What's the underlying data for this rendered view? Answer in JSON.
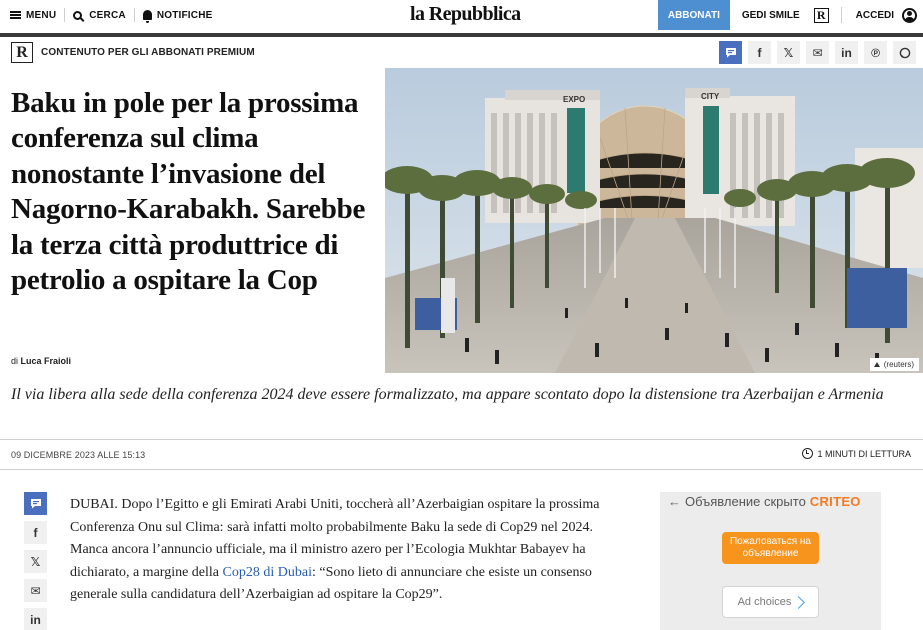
{
  "nav": {
    "menu_label": "MENU",
    "search_label": "CERCA",
    "notifications_label": "NOTIFICHE",
    "logo_text": "la Repubblica",
    "subscribe_label": "ABBONATI",
    "gedi_label": "GEDI SMILE",
    "r_logo": "R",
    "login_label": "ACCEDI"
  },
  "premium": {
    "logo": "R",
    "label": "CONTENUTO PER GLI ABBONATI PREMIUM"
  },
  "share": {
    "facebook": "f",
    "x": "𝕏",
    "email": "✉",
    "linkedin": "in",
    "pinterest": "℗"
  },
  "article": {
    "headline": "Baku in pole per la prossima conferenza sul clima nonostante l’invasione del Nagorno-Karabakh. Sarebbe la terza città produttrice di petrolio a ospitare la Cop",
    "byline_prefix": "di",
    "author": "Luca Fraioli",
    "photo_credit": "(reuters)",
    "subheadline": "Il via libera alla sede della conferenza 2024 deve essere formalizzato, ma appare scontato dopo la distensione tra Azerbaijan e Armenia",
    "date": "09 DICEMBRE 2023 ALLE 15:13",
    "read_time": "1 MINUTI DI LETTURA",
    "body_part1": "DUBAI. Dopo l’Egitto e gli Emirati Arabi Uniti, toccherà all’Azerbaigian ospitare la prossima Conferenza Onu sul Clima: sarà infatti molto probabilmente Baku la sede di Cop29 nel 2024. Manca ancora l’annuncio ufficiale, ma il ministro azero per l’Ecologia Mukhtar Babayev ha dichiarato, a margine della ",
    "body_link": "Cop28 di Dubai",
    "body_part2": ": “Sono lieto di annunciare che esiste un consenso generale sulla candidatura dell’Azerbaigian ad ospitare la Cop29”."
  },
  "photo_signs": {
    "left": "EXPO",
    "right": "CITY"
  },
  "ad": {
    "header_text": "Объявление скрыто",
    "brand": "CRITEO",
    "report_button": "Пожаловаться на объявление",
    "choices_label": "Ad choices"
  },
  "colors": {
    "accent_blue": "#4d8fd1",
    "share_active": "#4a6fbf",
    "link": "#2a5db0",
    "criteo_orange": "#f47a20"
  }
}
